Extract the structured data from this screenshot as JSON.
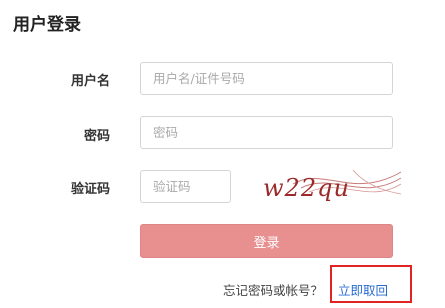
{
  "page": {
    "title": "用户登录"
  },
  "form": {
    "username_label": "用户名",
    "username_placeholder": "用户名/证件号码",
    "username_value": "",
    "password_label": "密码",
    "password_placeholder": "密码",
    "password_value": "",
    "captcha_label": "验证码",
    "captcha_placeholder": "验证码",
    "captcha_value": "",
    "captcha_image_text": "w22qu",
    "login_button": "登录"
  },
  "footer": {
    "forgot_text": "忘记密码或帐号？",
    "retrieve_link": "立即取回"
  },
  "colors": {
    "login_button": "#e89090",
    "link": "#2a6bd0",
    "highlight_box": "#e02424",
    "captcha_text": "#9b2a2a"
  }
}
